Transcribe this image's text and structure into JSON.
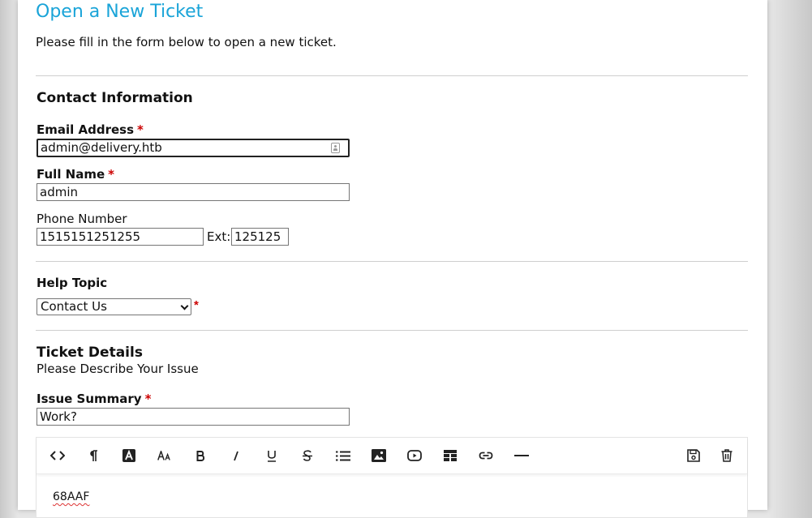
{
  "page": {
    "title": "Open a New Ticket",
    "intro": "Please fill in the form below to open a new ticket."
  },
  "contact": {
    "heading": "Contact Information",
    "email": {
      "label": "Email Address",
      "required": "*",
      "value": "admin@delivery.htb"
    },
    "name": {
      "label": "Full Name",
      "required": "*",
      "value": "admin"
    },
    "phone": {
      "label": "Phone Number",
      "value": "1515151251255",
      "ext_label": "Ext:",
      "ext_value": "125125"
    }
  },
  "help_topic": {
    "heading": "Help Topic",
    "selected": "Contact Us",
    "required": "*"
  },
  "ticket": {
    "heading": "Ticket Details",
    "subheading": "Please Describe Your Issue",
    "summary": {
      "label": "Issue Summary",
      "required": "*",
      "value": "Work?"
    },
    "editor": {
      "toolbar": [
        "code-view-icon",
        "paragraph-icon",
        "text-color-icon",
        "font-size-icon",
        "bold-icon",
        "italic-icon",
        "underline-icon",
        "strikethrough-icon",
        "list-icon",
        "image-icon",
        "video-icon",
        "table-icon",
        "link-icon",
        "horizontal-rule-icon",
        "save-draft-icon",
        "delete-draft-icon"
      ],
      "body": "68AAF"
    }
  },
  "colors": {
    "title": "#1aa4d8",
    "required": "#cc0000"
  }
}
